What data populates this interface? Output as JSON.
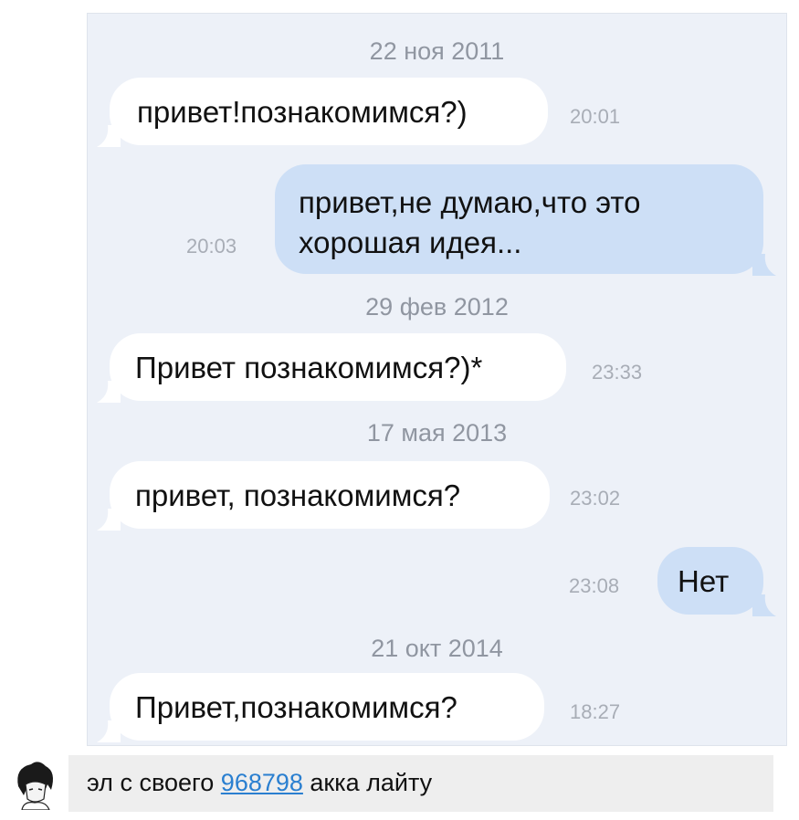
{
  "conversation": {
    "date_1": "22 ноя 2011",
    "msg_1": {
      "text": "привет!познакомимся?)",
      "time": "20:01"
    },
    "msg_2": {
      "line_1": "привет,не думаю,что это",
      "line_2": "хорошая идея...",
      "time": "20:03"
    },
    "date_2": "29 фев 2012",
    "msg_3": {
      "text": "Привет познакомимся?)*",
      "time": "23:33"
    },
    "date_3": "17 мая 2013",
    "msg_4": {
      "text": "привет, познакомимся?",
      "time": "23:02"
    },
    "msg_5": {
      "text": "Нет",
      "time": "23:08"
    },
    "date_4": "21 окт 2014",
    "msg_6": {
      "text": "Привет,познакомимся?",
      "time": "18:27"
    }
  },
  "comment": {
    "text_before": "эл с своего ",
    "link": "968798",
    "text_after": " акка лайту"
  },
  "colors": {
    "chat_background": "#edf1f8",
    "incoming_bubble": "#ffffff",
    "outgoing_bubble": "#cddff6",
    "link": "#2a7fd0"
  },
  "icons": {
    "avatar": "anime-character-avatar"
  }
}
